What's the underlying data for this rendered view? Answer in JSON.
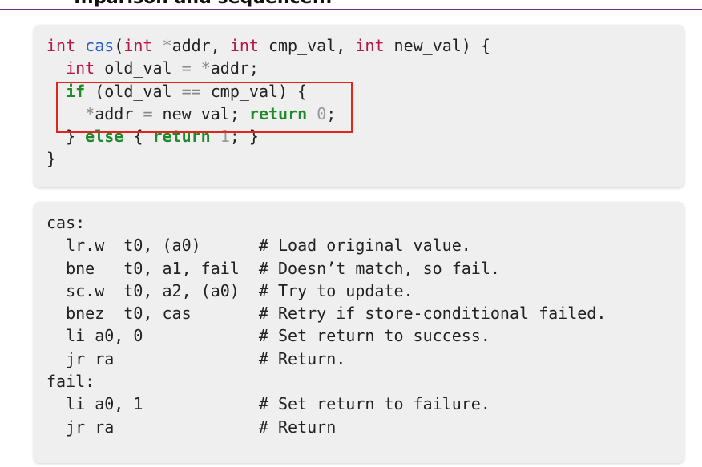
{
  "header": {
    "clipped_title": "...parison and sequence..."
  },
  "c_code": {
    "l1": {
      "int1": "int",
      "fn": "cas",
      "p1": "(",
      "int2": "int",
      "p2": " ",
      "star": "*",
      "p3": "addr, ",
      "int3": "int",
      "p4": " cmp_val, ",
      "int4": "int",
      "p5": " new_val) {"
    },
    "l2": {
      "indent": "  ",
      "int": "int",
      "p1": " old_val ",
      "eq": "=",
      "p2": " ",
      "star": "*",
      "p3": "addr;"
    },
    "l3": {
      "indent": "  ",
      "if": "if",
      "p1": " (old_val ",
      "eqeq": "==",
      "p2": " cmp_val) {"
    },
    "l4": {
      "indent": "    ",
      "star": "*",
      "p1": "addr ",
      "eq": "=",
      "p2": " new_val; ",
      "ret": "return",
      "sp": " ",
      "num": "0",
      "semi": ";"
    },
    "l5": {
      "indent": "  } ",
      "else": "else",
      "p1": " { ",
      "ret": "return",
      "sp": " ",
      "num": "1",
      "semi": "; }"
    },
    "l6": {
      "text": "}"
    }
  },
  "asm_code": {
    "lines": [
      "cas:",
      "  lr.w  t0, (a0)      # Load original value.",
      "  bne   t0, a1, fail  # Doesn’t match, so fail.",
      "  sc.w  t0, a2, (a0)  # Try to update.",
      "  bnez  t0, cas       # Retry if store-conditional failed.",
      "  li a0, 0            # Set return to success.",
      "  jr ra               # Return.",
      "fail:",
      "  li a0, 1            # Set return to failure.",
      "  jr ra               # Return"
    ]
  },
  "colors": {
    "keyword_type": "#b5174a",
    "function_name": "#2a62c8",
    "keyword_control": "#1f8a2c",
    "highlight_box": "#e0261c",
    "accent_rule": "#6b2d7a"
  }
}
